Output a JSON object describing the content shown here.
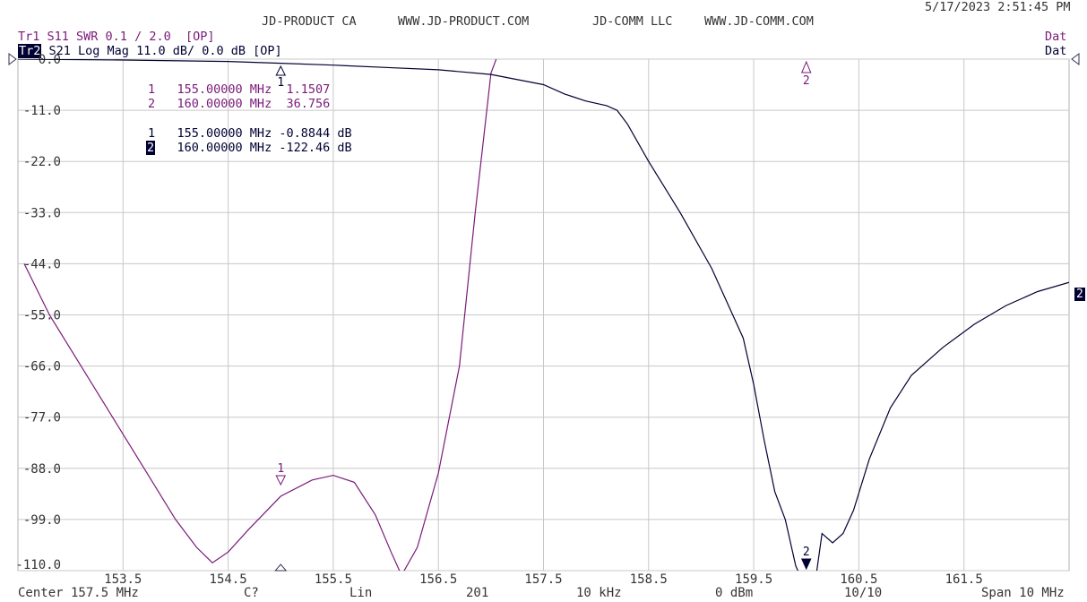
{
  "header": {
    "brand1": "JD-PRODUCT CA",
    "url1": "WWW.JD-PRODUCT.COM",
    "brand2": "JD-COMM LLC",
    "url2": "WWW.JD-COMM.COM",
    "timestamp": "5/17/2023 2:51:45 PM"
  },
  "traces": {
    "tr1": {
      "label": "Tr1",
      "desc": "S11 SWR 0.1 / 2.0  [OP]",
      "right": "Dat",
      "color": "#7a1a7a"
    },
    "tr2": {
      "label": "Tr2",
      "desc": "S21 Log Mag 11.0 dB/ 0.0 dB [OP]",
      "right": "Dat",
      "color": "#000033"
    }
  },
  "markers": {
    "tr1": [
      {
        "num": "1",
        "freq": "155.00000 MHz",
        "value": "1.1507"
      },
      {
        "num": "2",
        "freq": "160.00000 MHz",
        "value": "36.756"
      }
    ],
    "tr2": [
      {
        "num": "1",
        "freq": "155.00000 MHz",
        "value": "-0.8844 dB"
      },
      {
        "num": "2",
        "freq": "160.00000 MHz",
        "value": "-122.46 dB"
      }
    ]
  },
  "footer": {
    "center": "Center 157.5 MHz",
    "cal": "C?",
    "sweep": "Lin",
    "points": "201",
    "ifbw": "10 kHz",
    "power": "0 dBm",
    "avg": "10/10",
    "span": "Span 10 MHz"
  },
  "trace_end_badge": "2",
  "chart_data": {
    "type": "line",
    "x_ticks": [
      "153.5",
      "154.5",
      "155.5",
      "156.5",
      "157.5",
      "158.5",
      "159.5",
      "160.5",
      "161.5"
    ],
    "y_ticks": [
      "0.0",
      "-11.0",
      "-22.0",
      "-33.0",
      "-44.0",
      "-55.0",
      "-66.0",
      "-77.0",
      "-88.0",
      "-99.0",
      "-110.0"
    ],
    "xlim": [
      152.5,
      162.5
    ],
    "ylim": [
      -110,
      0
    ],
    "grid": true,
    "series": [
      {
        "name": "Tr1",
        "color": "#7a1a7a",
        "x": [
          152.56,
          152.8,
          153.1,
          153.4,
          153.7,
          154.0,
          154.2,
          154.35,
          154.5,
          154.7,
          155.0,
          155.3,
          155.5,
          155.7,
          155.9,
          156.05,
          156.15,
          156.3,
          156.5,
          156.7,
          156.85,
          157.0,
          157.05
        ],
        "y": [
          -44,
          -55,
          -66,
          -77,
          -88,
          -99,
          -105,
          -108.3,
          -106,
          -101,
          -94,
          -90.5,
          -89.5,
          -91,
          -98,
          -106,
          -111,
          -105,
          -89,
          -66,
          -33,
          -3,
          0
        ]
      },
      {
        "name": "Tr2",
        "color": "#000033",
        "x": [
          152.5,
          153.5,
          154.5,
          155.0,
          155.5,
          156.0,
          156.5,
          157.0,
          157.5,
          157.7,
          157.9,
          158.1,
          158.2,
          158.3,
          158.5,
          158.8,
          159.1,
          159.4,
          159.5,
          159.6,
          159.7,
          159.8,
          159.9,
          160.0,
          160.1,
          160.15,
          160.25,
          160.35,
          160.45,
          160.6,
          160.8,
          161.0,
          161.3,
          161.6,
          161.9,
          162.2,
          162.5
        ],
        "y": [
          0,
          -0.2,
          -0.5,
          -0.88,
          -1.3,
          -1.8,
          -2.3,
          -3.3,
          -5.5,
          -7.5,
          -9,
          -10,
          -11,
          -14,
          -22,
          -33,
          -45,
          -60,
          -70,
          -82,
          -93,
          -99,
          -109,
          -114,
          -110,
          -102,
          -104,
          -102,
          -97,
          -86,
          -75,
          -68,
          -62,
          -57,
          -53,
          -50,
          -48
        ]
      }
    ],
    "marker_points": [
      {
        "trace": "Tr1",
        "num": "1",
        "x": 155.0,
        "y": -91.5,
        "style": "open"
      },
      {
        "trace": "Tr1",
        "num": "2",
        "x": 160.0,
        "y": 0.0,
        "style": "open-offscale"
      },
      {
        "trace": "Tr2",
        "num": "1",
        "x": 155.0,
        "y": 0.0,
        "style": "open"
      },
      {
        "trace": "Tr2",
        "num": "2",
        "x": 160.0,
        "y": -110,
        "style": "filled"
      }
    ]
  }
}
